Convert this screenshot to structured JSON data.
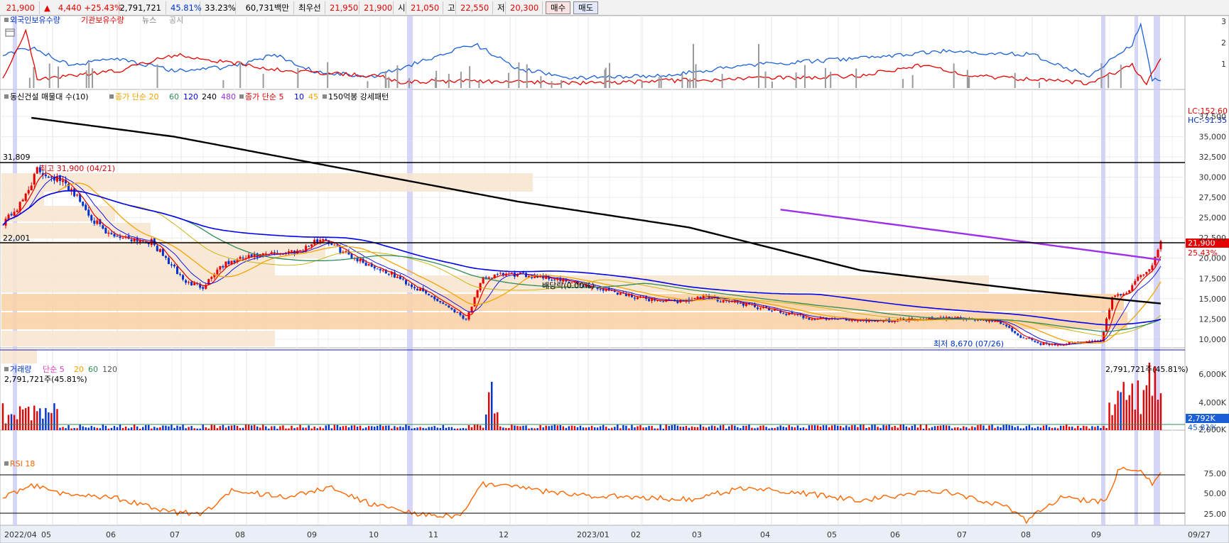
{
  "topbar": {
    "price": "21,900",
    "arrow": "▲",
    "change": "4,440",
    "change_pct": "+25.43%",
    "volume": "2,791,721",
    "vol_ratio": "45.81%",
    "turnover": "33.23%",
    "amount": "60,731백만",
    "best_ask_label": "최우선",
    "best_ask": "21,950",
    "best_bid": "21,900",
    "open_label": "시",
    "open": "21,050",
    "high_label": "고",
    "high": "22,550",
    "low_label": "저",
    "low": "20,300",
    "buy_button": "매수",
    "sell_button": "매도"
  },
  "holdings_panel": {
    "legend": [
      "외국인보유수량",
      "기관보유수량",
      "뉴스",
      "공시"
    ],
    "yticks": [
      "3",
      "2",
      "1"
    ]
  },
  "price_panel": {
    "legend": {
      "title": "동신건설 매물대 수(10)",
      "ma_label": "종가 단순 20",
      "ma_periods": [
        "60",
        "120",
        "240",
        "480"
      ],
      "ma2_label": "종가 단순 5",
      "ma2_periods": [
        "10",
        "45"
      ],
      "pattern": "150억봉 강세패턴"
    },
    "lc": "LC:152.60",
    "hc": "HC:-31.35",
    "yticks": [
      "37,500",
      "35,000",
      "32,500",
      "30,000",
      "27,500",
      "25,000",
      "22,500",
      "20,000",
      "17,500",
      "15,000",
      "12,500",
      "10,000"
    ],
    "hline_high": "31,809",
    "hline_mid": "22,001",
    "high_note": "최고 31,900 (04/21)",
    "low_note": "최저 8,670 (07/26)",
    "dividend_note": "배당락(0.00%)",
    "current_price": "21,900",
    "current_pct": "25.43%"
  },
  "volume_panel": {
    "legend": {
      "title": "거래량",
      "ma_label": "단순 5",
      "periods": [
        "20",
        "60",
        "120"
      ]
    },
    "left_value": "2,791,721주(45.81%)",
    "right_value": "2,791,721주(45.81%)",
    "yticks": [
      "6,000K",
      "4,000K",
      "2,000K"
    ],
    "current_label": "2,792K",
    "current_pct": "45.81%"
  },
  "rsi_panel": {
    "label": "RSI 18",
    "yticks": [
      "75.00",
      "50.00",
      "25.00"
    ]
  },
  "x_axis": [
    "2022/04",
    "05",
    "06",
    "07",
    "08",
    "09",
    "10",
    "11",
    "12",
    "2023/01",
    "02",
    "03",
    "04",
    "05",
    "06",
    "07",
    "08",
    "09",
    "09/27"
  ],
  "colors": {
    "up": "#e60000",
    "down": "#0033cc",
    "ma5": "#e60000",
    "ma20": "#f5a300",
    "ma60": "#2e8b57",
    "ma120": "#0000ee",
    "ma240": "#000000",
    "ma480": "#9b30e8",
    "rsi": "#ff6600",
    "volume_profile": "#f7e6d2",
    "volume_profile_peak": "#fbd3a8",
    "highlight": "#c8c8f5"
  }
}
